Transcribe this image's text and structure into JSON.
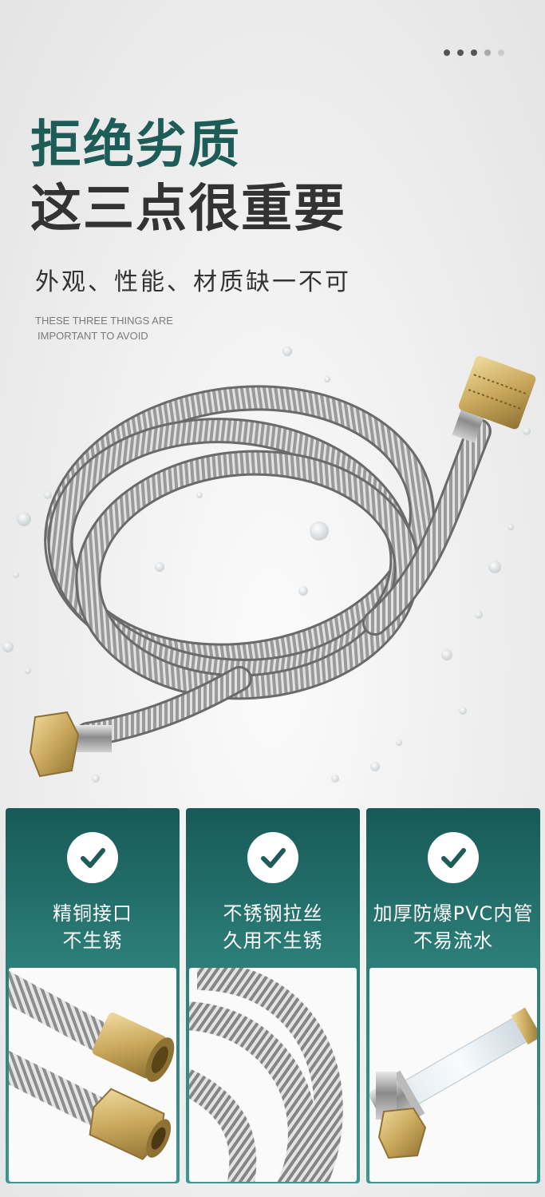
{
  "header": {
    "title_line1": "拒绝劣质",
    "title_line2": "这三点很重要",
    "subtitle": "外观、性能、材质缺一不可",
    "english_line1": "THESE THREE THINGS ARE",
    "english_line2": "IMPORTANT TO AVOID"
  },
  "carousel": {
    "dot_count": 5
  },
  "features": [
    {
      "icon": "check-icon",
      "line1": "精铜接口",
      "line2": "不生锈"
    },
    {
      "icon": "check-icon",
      "line1": "不锈钢拉丝",
      "line2": "久用不生锈"
    },
    {
      "icon": "check-icon",
      "line1": "加厚防爆PVC内管",
      "line2": "不易流水"
    }
  ],
  "colors": {
    "accent": "#1e5c57",
    "card_top": "#175a57",
    "card_bottom": "#3f9590",
    "brass": "#c9a85c"
  }
}
